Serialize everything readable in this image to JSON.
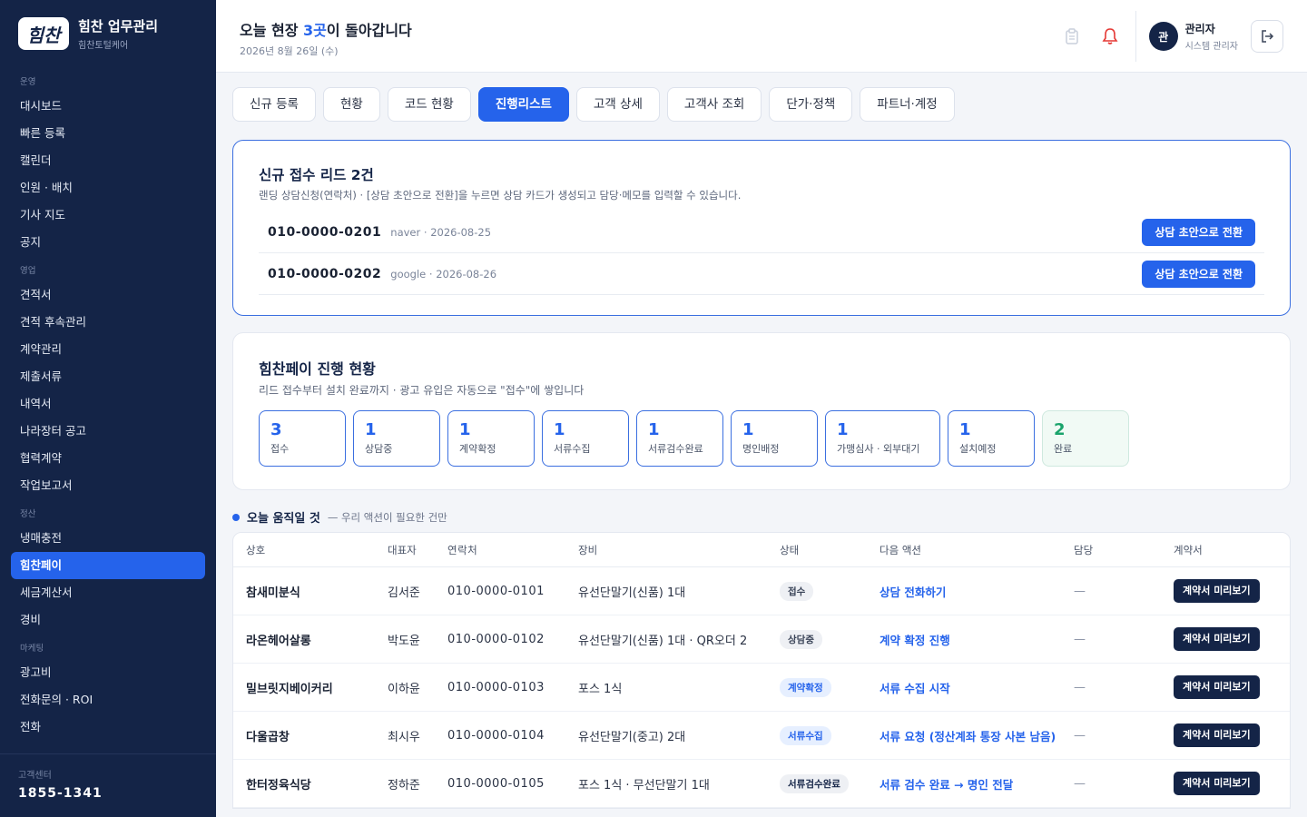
{
  "brand": {
    "logo_text": "힘찬",
    "title": "힘찬 업무관리",
    "subtitle": "힘찬토털케어"
  },
  "sidebar": {
    "sections": [
      {
        "label": "운영",
        "items": [
          "대시보드",
          "빠른 등록",
          "캘린더",
          "인원 · 배치",
          "기사 지도",
          "공지"
        ]
      },
      {
        "label": "영업",
        "items": [
          "견적서",
          "견적 후속관리",
          "계약관리",
          "제출서류",
          "내역서",
          "나라장터 공고",
          "협력계약",
          "작업보고서"
        ]
      },
      {
        "label": "정산",
        "items": [
          "냉매충전",
          "힘찬페이",
          "세금계산서",
          "경비"
        ]
      },
      {
        "label": "마케팅",
        "items": [
          "광고비",
          "전화문의 · ROI",
          "전화"
        ]
      }
    ],
    "active_item": "힘찬페이",
    "footer": {
      "label": "고객센터",
      "phone": "1855-1341"
    }
  },
  "header": {
    "greet_prefix": "오늘 현장 ",
    "greet_count": "3곳",
    "greet_suffix": "이 돌아갑니다",
    "date": "2026년 8월 26일 (수)",
    "user": {
      "avatar": "관",
      "name": "관리자",
      "role": "시스템 관리자"
    }
  },
  "tabs": [
    "신규 등록",
    "현황",
    "코드 현황",
    "진행리스트",
    "고객 상세",
    "고객사 조회",
    "단가·정책",
    "파트너·계정"
  ],
  "active_tab": "진행리스트",
  "leads": {
    "title": "신규 접수 리드 2건",
    "desc": "랜딩 상담신청(연락처) · [상담 초안으로 전환]을 누르면 상담 카드가 생성되고 담당·메모를 입력할 수 있습니다.",
    "rows": [
      {
        "phone": "010-0000-0201",
        "meta": "naver · 2026-08-25",
        "button": "상담 초안으로 전환"
      },
      {
        "phone": "010-0000-0202",
        "meta": "google · 2026-08-26",
        "button": "상담 초안으로 전환"
      }
    ]
  },
  "progress": {
    "title": "힘찬페이 진행 현황",
    "desc": "리드 접수부터 설치 완료까지 · 광고 유입은 자동으로 \"접수\"에 쌓입니다",
    "stages": [
      {
        "count": "3",
        "label": "접수"
      },
      {
        "count": "1",
        "label": "상담중"
      },
      {
        "count": "1",
        "label": "계약확정"
      },
      {
        "count": "1",
        "label": "서류수집"
      },
      {
        "count": "1",
        "label": "서류검수완료"
      },
      {
        "count": "1",
        "label": "명인배정"
      },
      {
        "count": "1",
        "label": "가맹심사 · 외부대기"
      },
      {
        "count": "1",
        "label": "설치예정"
      },
      {
        "count": "2",
        "label": "완료"
      }
    ]
  },
  "today": {
    "title": "오늘 움직일 것",
    "subtitle": "— 우리 액션이 필요한 건만",
    "columns": [
      "상호",
      "대표자",
      "연락처",
      "장비",
      "상태",
      "다음 액션",
      "담당",
      "계약서"
    ],
    "rows": [
      {
        "name": "참새미분식",
        "owner": "김서준",
        "phone": "010-0000-0101",
        "device": "유선단말기(신품) 1대",
        "status": "접수",
        "action": "상담 전화하기",
        "manager": "—",
        "button": "계약서 미리보기"
      },
      {
        "name": "라온헤어살롱",
        "owner": "박도윤",
        "phone": "010-0000-0102",
        "device": "유선단말기(신품) 1대 · QR오더 2",
        "status": "상담중",
        "action": "계약 확정 진행",
        "manager": "—",
        "button": "계약서 미리보기"
      },
      {
        "name": "밀브릿지베이커리",
        "owner": "이하윤",
        "phone": "010-0000-0103",
        "device": "포스 1식",
        "status": "계약확정",
        "action": "서류 수집 시작",
        "manager": "—",
        "button": "계약서 미리보기"
      },
      {
        "name": "다울곱창",
        "owner": "최시우",
        "phone": "010-0000-0104",
        "device": "유선단말기(중고) 2대",
        "status": "서류수집",
        "action": "서류 요청 (정산계좌 통장 사본 남음)",
        "manager": "—",
        "button": "계약서 미리보기"
      },
      {
        "name": "한터정육식당",
        "owner": "정하준",
        "phone": "010-0000-0105",
        "device": "포스 1식 · 무선단말기 1대",
        "status": "서류검수완료",
        "action": "서류 검수 완료 → 명인 전달",
        "manager": "—",
        "button": "계약서 미리보기"
      }
    ]
  },
  "status_colors": {
    "접수": {
      "bg": "#eef0f4",
      "fg": "#3a4458"
    },
    "상담중": {
      "bg": "#eef0f4",
      "fg": "#3a4458"
    },
    "계약확정": {
      "bg": "#e6efff",
      "fg": "#2563eb"
    },
    "서류수집": {
      "bg": "#e6efff",
      "fg": "#2563eb"
    },
    "서류검수완료": {
      "bg": "#eef0f4",
      "fg": "#142447"
    }
  }
}
